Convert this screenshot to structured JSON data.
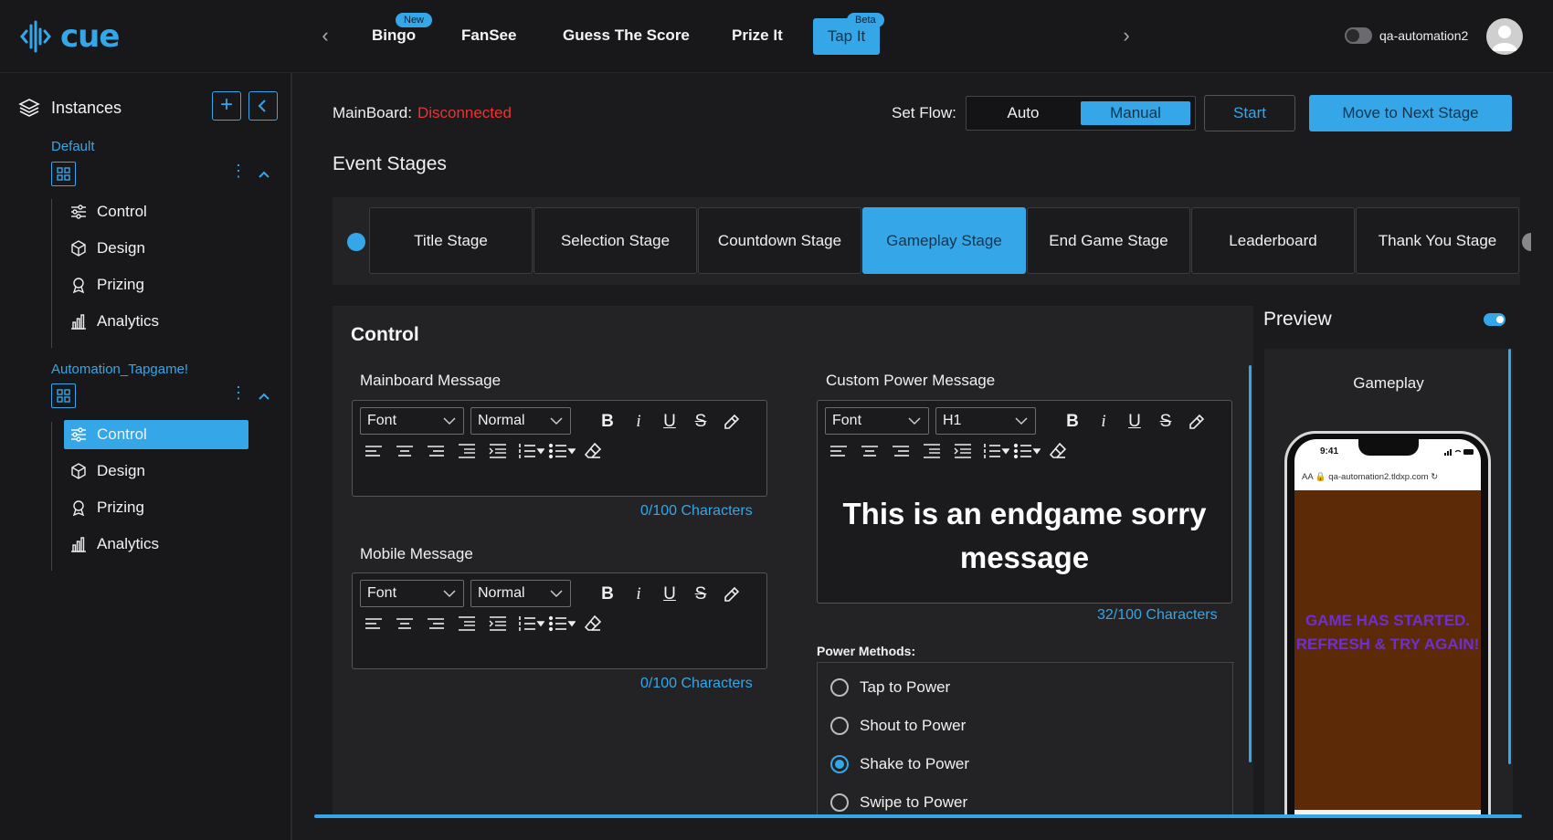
{
  "colors": {
    "accent": "#35a6e8",
    "danger": "#e83434",
    "background": "#1b1b1e",
    "panel": "#232326",
    "game_bg": "#5c2a06",
    "game_text": "#6e2fd1"
  },
  "brand": {
    "name": "cue"
  },
  "nav": {
    "tabs": [
      {
        "label": "Bingo",
        "badge": "New"
      },
      {
        "label": "FanSee"
      },
      {
        "label": "Guess The Score"
      },
      {
        "label": "Prize It"
      },
      {
        "label": "Tap It",
        "badge": "Beta",
        "active": true
      }
    ],
    "user": "qa-automation2"
  },
  "sidebar": {
    "title": "Instances",
    "groups": [
      {
        "name": "Default",
        "items": [
          "Control",
          "Design",
          "Prizing",
          "Analytics"
        ]
      },
      {
        "name": "Automation_Tapgame!",
        "items": [
          "Control",
          "Design",
          "Prizing",
          "Analytics"
        ],
        "active_item": "Control"
      }
    ]
  },
  "header": {
    "mainboard_label": "MainBoard:",
    "mainboard_status": "Disconnected",
    "set_flow_label": "Set Flow:",
    "flow_options": [
      "Auto",
      "Manual"
    ],
    "flow_selected": "Manual",
    "start_label": "Start",
    "next_label": "Move to Next Stage"
  },
  "event_stages": {
    "title": "Event Stages",
    "stages": [
      "Title Stage",
      "Selection Stage",
      "Countdown Stage",
      "Gameplay Stage",
      "End Game Stage",
      "Leaderboard",
      "Thank You Stage"
    ],
    "active": "Gameplay Stage"
  },
  "control": {
    "title": "Control",
    "mainboard_message": {
      "label": "Mainboard Message",
      "font": "Font",
      "size": "Normal",
      "count": "0/100 Characters"
    },
    "mobile_message": {
      "label": "Mobile Message",
      "font": "Font",
      "size": "Normal",
      "count": "0/100 Characters"
    },
    "custom_power_message": {
      "label": "Custom Power Message",
      "font": "Font",
      "size": "H1",
      "content": "This is an endgame sorry message",
      "count": "32/100 Characters"
    },
    "power_methods": {
      "label": "Power Methods:",
      "options": [
        "Tap to Power",
        "Shout to Power",
        "Shake to Power",
        "Swipe to Power"
      ],
      "selected": "Shake to Power"
    }
  },
  "preview": {
    "title": "Preview",
    "enabled": true,
    "stage_name": "Gameplay",
    "phone_time": "9:41",
    "url": "qa-automation2.tldxp.com",
    "url_prefix": "AA",
    "game_message": "GAME HAS STARTED. REFRESH & TRY AGAIN!"
  }
}
